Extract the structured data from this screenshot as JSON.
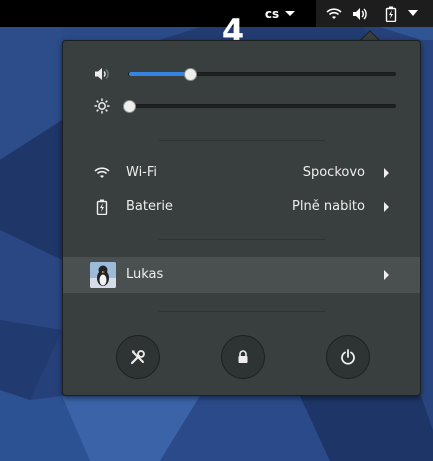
{
  "overlay": {
    "step_number": "4"
  },
  "topbar": {
    "keyboard_layout": "cs",
    "system_icons": [
      "wifi-icon",
      "volume-icon",
      "battery-icon",
      "chevron-down-icon"
    ]
  },
  "menu": {
    "volume": {
      "icon": "volume-low-icon",
      "level": 0.23
    },
    "brightness": {
      "icon": "brightness-icon",
      "level": 0.0
    },
    "items": [
      {
        "icon": "wifi-icon",
        "label": "Wi-Fi",
        "value": "Spockovo"
      },
      {
        "icon": "battery-icon",
        "label": "Baterie",
        "value": "Plně nabito"
      }
    ],
    "user": {
      "name": "Lukas",
      "icon": "avatar"
    },
    "actions": [
      {
        "icon": "settings-icon"
      },
      {
        "icon": "lock-icon"
      },
      {
        "icon": "power-icon"
      }
    ]
  },
  "colors": {
    "topbar": "#000000",
    "menu_bg": "#393f3f",
    "accent": "#3584e4",
    "text": "#eeeeec"
  }
}
